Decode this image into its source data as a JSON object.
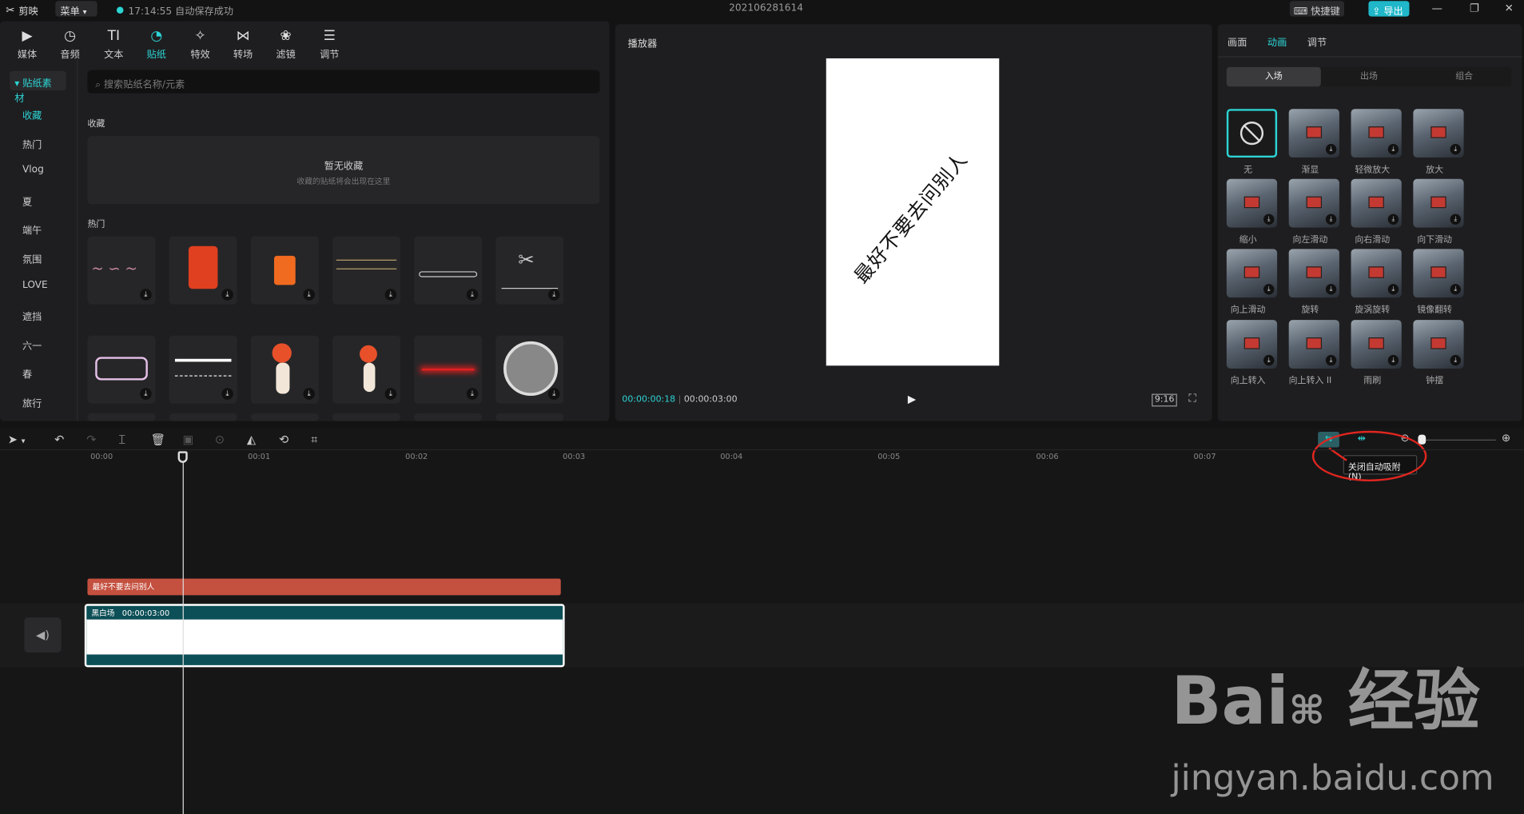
{
  "app": {
    "name": "剪映",
    "menu_label": "菜单",
    "save_status": "17:14:55 自动保存成功",
    "project_name": "202106281614",
    "shortcut_label": "快捷键",
    "export_label": "导出"
  },
  "toolbar": [
    {
      "label": "媒体",
      "icon": "media-icon"
    },
    {
      "label": "音频",
      "icon": "audio-icon"
    },
    {
      "label": "文本",
      "icon": "text-icon"
    },
    {
      "label": "贴纸",
      "icon": "sticker-icon"
    },
    {
      "label": "特效",
      "icon": "effects-icon"
    },
    {
      "label": "转场",
      "icon": "transition-icon"
    },
    {
      "label": "滤镜",
      "icon": "filter-icon"
    },
    {
      "label": "调节",
      "icon": "adjust-icon"
    }
  ],
  "sidebar": {
    "header": "贴纸素材",
    "items": [
      "收藏",
      "热门",
      "Vlog",
      "夏",
      "端午",
      "氛围",
      "LOVE",
      "遮挡",
      "六一",
      "春",
      "旅行"
    ]
  },
  "search": {
    "placeholder": "搜索贴纸名称/元素"
  },
  "favorites": {
    "title": "收藏",
    "empty_title": "暂无收藏",
    "empty_hint": "收藏的贴纸将会出现在这里"
  },
  "hot": {
    "title": "热门"
  },
  "player": {
    "title": "播放器",
    "current_time": "00:00:00:18",
    "total_time": "00:00:03:00",
    "ratio": "9:16",
    "preview_text": "最好不要去问别人"
  },
  "right_panel": {
    "tabs": [
      "画面",
      "动画",
      "调节"
    ],
    "segments": [
      "入场",
      "出场",
      "组合"
    ],
    "animations": [
      "无",
      "渐显",
      "轻微放大",
      "放大",
      "缩小",
      "向左滑动",
      "向右滑动",
      "向下滑动",
      "向上滑动",
      "旋转",
      "旋涡旋转",
      "镜像翻转",
      "向上转入",
      "向上转入 II",
      "雨刷",
      "钟摆"
    ]
  },
  "timeline": {
    "ticks": [
      "00:00",
      "00:01",
      "00:02",
      "00:03",
      "00:04",
      "00:05",
      "00:06",
      "00:07"
    ],
    "tooltip": "关闭自动吸附(N)",
    "text_clip": "最好不要去问别人",
    "video_clip_name": "黑白场",
    "video_clip_duration": "00:00:03:00"
  },
  "colors": {
    "accent": "#2dd4d4",
    "text_clip": "#c4503f",
    "video_clip": "#0d4f57",
    "annotation": "#e0261f"
  }
}
